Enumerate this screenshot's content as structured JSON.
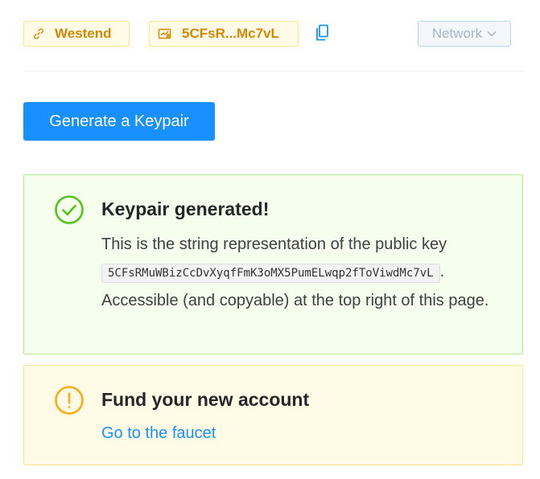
{
  "header": {
    "network_tag": {
      "label": "Westend",
      "icon": "link-icon"
    },
    "address_tag": {
      "label": "5CFsR...Mc7vL",
      "icon": "wallet-icon"
    },
    "copy_icon": "copy-icon",
    "network_select": {
      "label": "Network",
      "icon": "chevron-down-icon"
    }
  },
  "actions": {
    "generate_label": "Generate a Keypair"
  },
  "success_alert": {
    "icon": "check-circle-icon",
    "title": "Keypair generated!",
    "text_before": "This is the string representation of the public key",
    "public_key": "5CFsRMuWBizCcDvXyqfFmK3oMX5PumELwqp2fToViwdMc7vL",
    "text_after": ". Accessible (and copyable) at the top right of this page."
  },
  "warning_alert": {
    "icon": "exclamation-circle-icon",
    "title": "Fund your new account",
    "link_label": "Go to the faucet"
  },
  "colors": {
    "primary": "#1890ff",
    "success_bg": "#f6ffed",
    "success_border": "#b7eb8f",
    "success_icon": "#52c41a",
    "warning_bg": "#fffbe6",
    "warning_border": "#ffe58f",
    "warning_icon": "#faad14",
    "tag_text": "#d48806"
  }
}
